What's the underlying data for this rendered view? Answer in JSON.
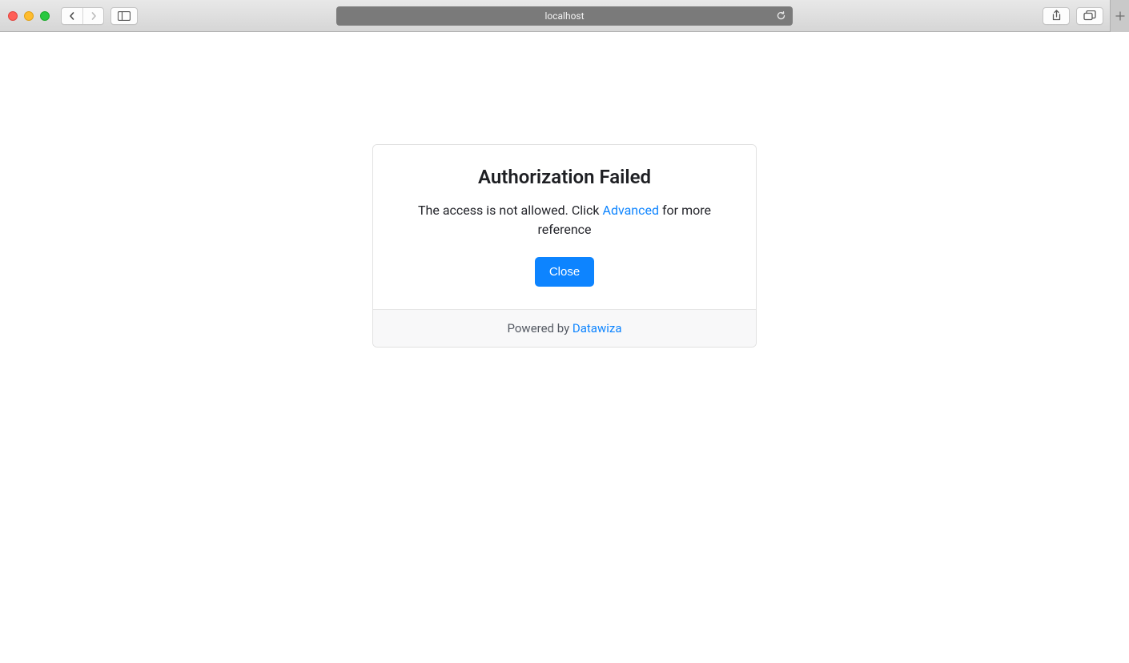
{
  "browser": {
    "url_display": "localhost"
  },
  "dialog": {
    "title": "Authorization Failed",
    "message_before": "The access is not allowed. Click ",
    "message_link": "Advanced",
    "message_after": " for more reference",
    "close_label": "Close"
  },
  "footer": {
    "powered_by_prefix": "Powered by ",
    "powered_by_link": "Datawiza"
  }
}
